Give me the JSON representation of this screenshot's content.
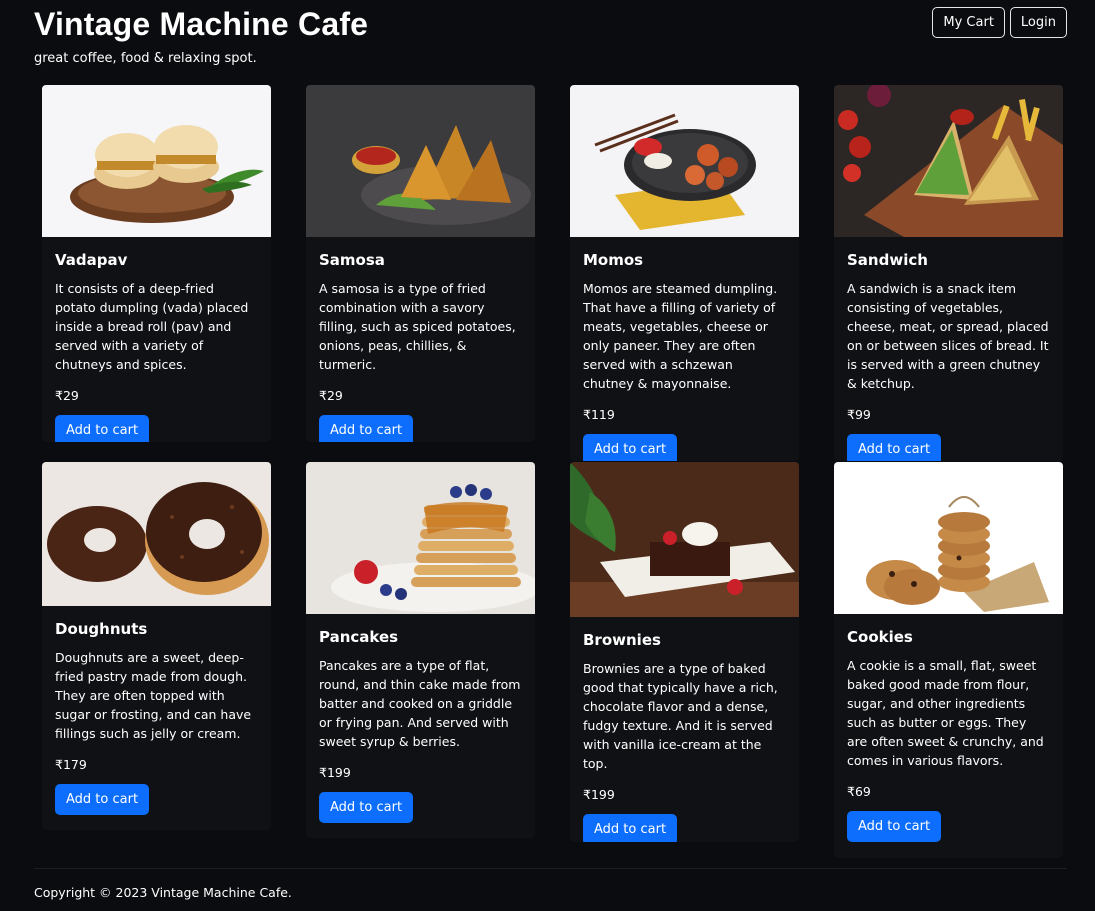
{
  "site": {
    "title": "Vintage Machine Cafe",
    "tagline": "great coffee, food & relaxing spot."
  },
  "nav": {
    "cart_label": "My Cart",
    "login_label": "Login"
  },
  "cart_button_label": "Add to cart",
  "products": [
    {
      "name": "Vadapav",
      "description": "It consists of a deep-fried potato dumpling (vada) placed inside a bread roll (pav) and served with a variety of chutneys and spices.",
      "price": "₹29"
    },
    {
      "name": "Samosa",
      "description": "A samosa is a type of fried combination with a savory filling, such as spiced potatoes, onions, peas, chillies, & turmeric.",
      "price": "₹29"
    },
    {
      "name": "Momos",
      "description": "Momos are steamed dumpling. That have a filling of variety of meats, vegetables, cheese or only paneer. They are often served with a schzewan chutney & mayonnaise.",
      "price": "₹119"
    },
    {
      "name": "Sandwich",
      "description": "A sandwich is a snack item consisting of vegetables, cheese, meat, or spread, placed on or between slices of bread. It is served with a green chutney & ketchup.",
      "price": "₹99"
    },
    {
      "name": "Doughnuts",
      "description": "Doughnuts are a sweet, deep-fried pastry made from dough. They are often topped with sugar or frosting, and can have fillings such as jelly or cream.",
      "price": "₹179"
    },
    {
      "name": "Pancakes",
      "description": "Pancakes are a type of flat, round, and thin cake made from batter and cooked on a griddle or frying pan. And served with sweet syrup & berries.",
      "price": "₹199"
    },
    {
      "name": "Brownies",
      "description": "Brownies are a type of baked good that typically have a rich, chocolate flavor and a dense, fudgy texture. And it is served with vanilla ice-cream at the top.",
      "price": "₹199"
    },
    {
      "name": "Cookies",
      "description": "A cookie is a small, flat, sweet baked good made from flour, sugar, and other ingredients such as butter or eggs. They are often sweet & crunchy, and comes in various flavors.",
      "price": "₹69"
    }
  ],
  "footer": {
    "copyright": "Copyright © 2023 Vintage Machine Cafe."
  },
  "colors": {
    "background": "#0b0c10",
    "card": "#101115",
    "primary_button": "#0d6efd"
  }
}
